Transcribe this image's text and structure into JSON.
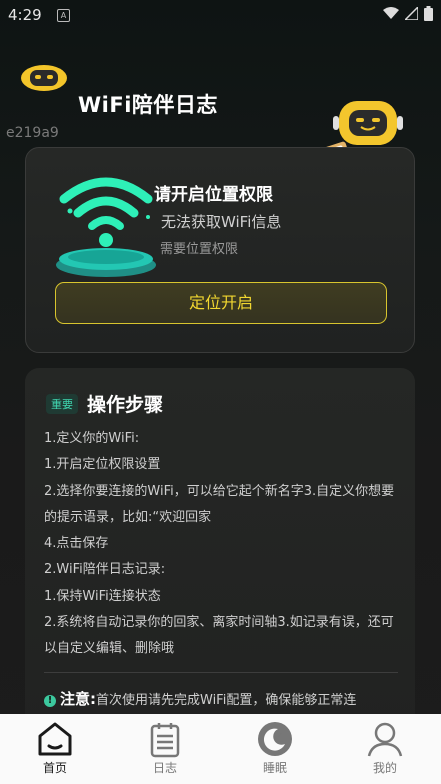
{
  "status_bar": {
    "time": "4:29",
    "a_icon": "A",
    "icons": [
      "wifi-icon",
      "signal-icon",
      "battery-icon"
    ]
  },
  "header": {
    "title": "WiFi陪伴日志",
    "code": "e219a9"
  },
  "permission_card": {
    "title": "请开启位置权限",
    "subtitle": "无法获取WiFi信息",
    "hint": "需要位置权限",
    "button_label": "定位开启"
  },
  "steps_card": {
    "badge": "重要",
    "title": "操作步骤",
    "lines": [
      "1.定义你的WiFi:",
      "1.开启定位权限设置",
      "2.选择你要连接的WiFi，可以给它起个新名字3.自定义你想要的提示语录，比如:“欢迎回家",
      "4.点击保存",
      "2.WiFi陪伴日志记录:",
      "1.保持WiFi连接状态",
      "2.系统将自动记录你的回家、离家时间轴3.如记录有误，还可以自定义编辑、删除哦"
    ],
    "note_label": "注意:",
    "note_text": "首次使用请先完成WiFi配置，确保能够正常连"
  },
  "tabs": [
    {
      "label": "首页",
      "icon": "home-icon",
      "active": true
    },
    {
      "label": "日志",
      "icon": "log-icon",
      "active": false
    },
    {
      "label": "睡眠",
      "icon": "sleep-icon",
      "active": false
    },
    {
      "label": "我的",
      "icon": "profile-icon",
      "active": false
    }
  ],
  "colors": {
    "accent_yellow": "#f2d730",
    "accent_teal": "#40d6b0",
    "tab_bar": "#fafafa"
  }
}
